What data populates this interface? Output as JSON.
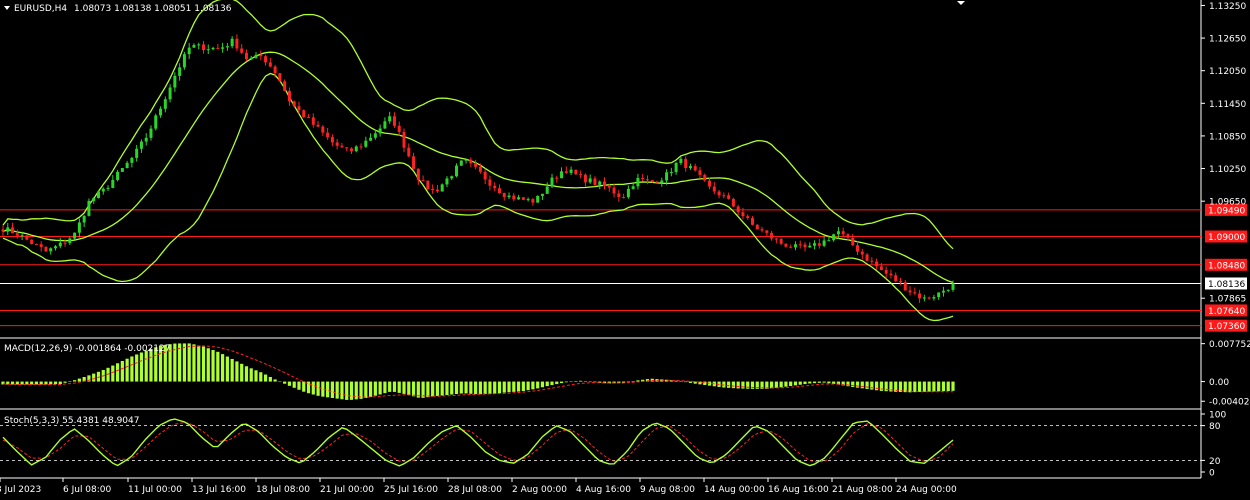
{
  "header": {
    "symbol": "EURUSD,H4",
    "ohlc": "1.08073 1.08138 1.08051 1.08136"
  },
  "macd_header": {
    "label": "MACD(12,26,9) -0.001864 -0.002127"
  },
  "stoch_header": {
    "label": "Stoch(5,3,3) 55.4381 48.9047"
  },
  "colors": {
    "background": "#000000",
    "bull_candle": "#2bd62b",
    "bear_candle": "#ff2222",
    "bands": "#adff2f",
    "hline": "#ff1a1a",
    "current_line": "#ffffff",
    "macd_hist": "#adff2f",
    "macd_signal": "#ff2222",
    "stoch_main": "#adff2f",
    "stoch_signal": "#ff2222"
  },
  "chart_data": [
    {
      "type": "candlestick",
      "title": "EURUSD,H4",
      "ylim": [
        1.0717,
        1.1335
      ],
      "price_ticks": [
        "1.13250",
        "1.12650",
        "1.12050",
        "1.11450",
        "1.10850",
        "1.10250",
        "1.09650",
        "1.07865"
      ],
      "price_tick_values": [
        1.1325,
        1.1265,
        1.1205,
        1.1145,
        1.1085,
        1.1025,
        1.0965,
        1.07865
      ],
      "horizontal_lines": [
        {
          "label": "1.09490",
          "value": 1.0949
        },
        {
          "label": "1.09000",
          "value": 1.09
        },
        {
          "label": "1.08480",
          "value": 1.0848
        },
        {
          "label": "1.07640",
          "value": 1.0764
        },
        {
          "label": "1.07360",
          "value": 1.0736
        }
      ],
      "current_price": {
        "label": "1.08136",
        "value": 1.08136
      },
      "x_labels": [
        "3 Jul 2023",
        "6 Jul 08:00",
        "11 Jul 00:00",
        "13 Jul 16:00",
        "18 Jul 08:00",
        "21 Jul 00:00",
        "25 Jul 16:00",
        "28 Jul 08:00",
        "2 Aug 00:00",
        "4 Aug 16:00",
        "9 Aug 08:00",
        "14 Aug 00:00",
        "16 Aug 16:00",
        "21 Aug 08:00",
        "24 Aug 00:00"
      ],
      "close_path": [
        1.0915,
        1.0905,
        1.0888,
        1.0872,
        1.0885,
        1.0905,
        1.0965,
        1.0985,
        1.1015,
        1.1045,
        1.1085,
        1.114,
        1.12,
        1.125,
        1.1248,
        1.1245,
        1.126,
        1.1225,
        1.1232,
        1.12,
        1.1145,
        1.112,
        1.1095,
        1.107,
        1.1055,
        1.107,
        1.1095,
        1.112,
        1.106,
        1.1,
        1.0982,
        1.101,
        1.104,
        1.102,
        1.0995,
        1.0975,
        1.0968,
        1.0965,
        1.1,
        1.1025,
        1.101,
        1.1,
        1.099,
        1.0972,
        1.1005,
        1.1,
        1.101,
        1.104,
        1.102,
        1.099,
        1.0975,
        1.095,
        1.0922,
        1.0905,
        1.0888,
        1.088,
        1.0878,
        1.089,
        1.091,
        1.0885,
        1.086,
        1.0838,
        1.082,
        1.08,
        1.0785,
        1.0795,
        1.0813
      ]
    },
    {
      "type": "bar",
      "title": "MACD(12,26,9) -0.001864 -0.002127",
      "ylim": [
        -0.0052,
        0.0085
      ],
      "tick_labels": [
        "0.007752",
        "0.00",
        "-0.004024"
      ],
      "tick_values": [
        0.007752,
        0.0,
        -0.004024
      ],
      "histogram_path": [
        -0.0006,
        -0.0006,
        -0.0006,
        -0.0006,
        -0.0005,
        0.0003,
        0.0013,
        0.0024,
        0.0038,
        0.0052,
        0.0064,
        0.0074,
        0.0078,
        0.0078,
        0.0071,
        0.006,
        0.0045,
        0.003,
        0.0018,
        0.0003,
        -0.001,
        -0.0022,
        -0.003,
        -0.0034,
        -0.0038,
        -0.0035,
        -0.0028,
        -0.002,
        -0.0026,
        -0.0034,
        -0.003,
        -0.0027,
        -0.0024,
        -0.0026,
        -0.0025,
        -0.0022,
        -0.002,
        -0.0015,
        -0.0008,
        -0.0002,
        0.0002,
        -0.0001,
        -0.0004,
        -0.0003,
        0.0002,
        0.0006,
        0.0004,
        0.0001,
        -0.0004,
        -0.0008,
        -0.0012,
        -0.0014,
        -0.0015,
        -0.0015,
        -0.0012,
        -0.0008,
        -0.0004,
        -0.0002,
        -0.0006,
        -0.0011,
        -0.0015,
        -0.0019,
        -0.0021,
        -0.0022,
        -0.0021,
        -0.002,
        -0.0019
      ],
      "signal_path": [
        -0.0005,
        -0.0006,
        -0.0006,
        -0.0006,
        -0.0006,
        -0.0003,
        0.0003,
        0.0012,
        0.0023,
        0.0035,
        0.0047,
        0.0058,
        0.0066,
        0.0072,
        0.0073,
        0.007,
        0.0062,
        0.0051,
        0.0039,
        0.0026,
        0.0012,
        -0.0002,
        -0.0013,
        -0.0022,
        -0.0029,
        -0.0032,
        -0.0031,
        -0.0028,
        -0.0027,
        -0.0029,
        -0.003,
        -0.0029,
        -0.0027,
        -0.0026,
        -0.0025,
        -0.0024,
        -0.0022,
        -0.0019,
        -0.0014,
        -0.0009,
        -0.0004,
        -0.0002,
        -0.0003,
        -0.0003,
        -0.0001,
        0.0002,
        0.0003,
        0.0002,
        0.0,
        -0.0003,
        -0.0007,
        -0.001,
        -0.0012,
        -0.0013,
        -0.0013,
        -0.0011,
        -0.0008,
        -0.0005,
        -0.0005,
        -0.0008,
        -0.0011,
        -0.0015,
        -0.0018,
        -0.002,
        -0.0021,
        -0.0021,
        -0.0021
      ]
    },
    {
      "type": "line",
      "title": "Stoch(5,3,3) 55.4381 48.9047",
      "ylim": [
        0,
        100
      ],
      "tick_labels": [
        "100",
        "80",
        "20",
        "0"
      ],
      "tick_values": [
        100,
        80,
        20,
        0
      ],
      "level_lines": [
        80,
        20
      ],
      "main_path": [
        60,
        35,
        12,
        25,
        55,
        75,
        55,
        30,
        10,
        25,
        55,
        80,
        92,
        85,
        60,
        40,
        65,
        85,
        70,
        45,
        25,
        15,
        35,
        60,
        78,
        60,
        40,
        20,
        10,
        25,
        50,
        70,
        80,
        60,
        35,
        20,
        15,
        30,
        60,
        80,
        70,
        45,
        20,
        12,
        35,
        70,
        85,
        75,
        50,
        25,
        15,
        30,
        55,
        80,
        70,
        45,
        20,
        10,
        25,
        55,
        85,
        88,
        65,
        40,
        18,
        15,
        35,
        55
      ],
      "signal_path": [
        55,
        42,
        24,
        24,
        40,
        62,
        62,
        42,
        22,
        22,
        42,
        65,
        82,
        86,
        72,
        52,
        55,
        72,
        72,
        55,
        35,
        22,
        28,
        45,
        65,
        66,
        52,
        32,
        18,
        20,
        38,
        58,
        74,
        70,
        50,
        30,
        20,
        25,
        45,
        68,
        74,
        58,
        35,
        18,
        25,
        50,
        75,
        80,
        62,
        38,
        22,
        24,
        42,
        65,
        72,
        58,
        35,
        18,
        18,
        38,
        68,
        84,
        75,
        52,
        28,
        18,
        25,
        49
      ]
    }
  ]
}
